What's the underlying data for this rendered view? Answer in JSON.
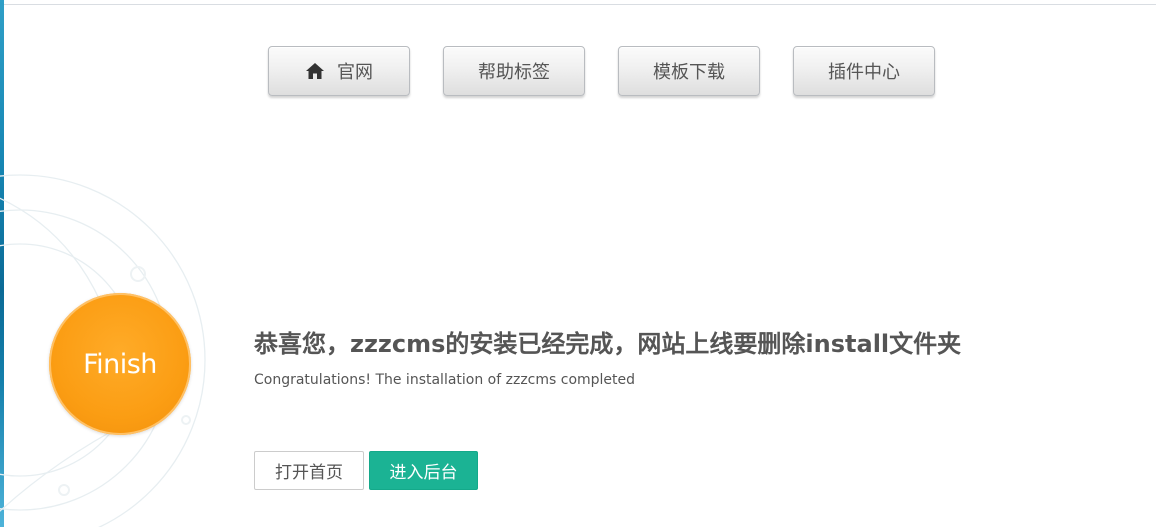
{
  "nav": {
    "items": [
      {
        "label": "官网",
        "icon": "home-icon"
      },
      {
        "label": "帮助标签"
      },
      {
        "label": "模板下载"
      },
      {
        "label": "插件中心"
      }
    ]
  },
  "finish": {
    "label": "Finish",
    "color": "#fb9d13"
  },
  "message": {
    "title": "恭喜您，zzzcms的安装已经完成，网站上线要删除install文件夹",
    "subtitle": "Congratulations! The installation of zzzcms completed"
  },
  "actions": {
    "open_home": "打开首页",
    "enter_admin": "进入后台",
    "admin_color": "#1bb394"
  }
}
